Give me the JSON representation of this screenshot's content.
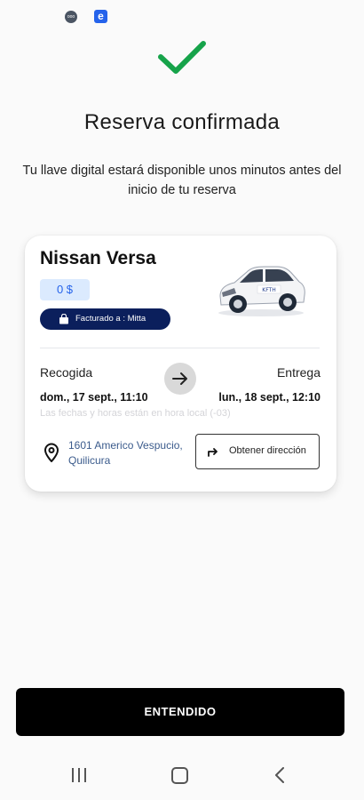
{
  "status_bar": {
    "dot_icon_text": "ooo",
    "e_icon_text": "e"
  },
  "confirmation": {
    "title": "Reserva confirmada",
    "subtitle": "Tu llave digital estará disponible unos minutos antes del inicio de tu reserva"
  },
  "booking_card": {
    "car_name": "Nissan Versa",
    "price": "0 $",
    "billing": "Facturado a : Mitta",
    "pickup": {
      "label": "Recogida",
      "date": "dom., 17 sept., 11:10"
    },
    "return": {
      "label": "Entrega",
      "date": "lun., 18 sept., 12:10"
    },
    "timezone_note": "Las fechas y horas están en hora local (-03)",
    "address": "1601 Americo Vespucio, Quilicura",
    "directions_button": "Obtener dirección"
  },
  "primary_button": "ENTENDIDO",
  "colors": {
    "accent_green": "#16a34a",
    "billing_badge": "#0b1f5c",
    "price_badge_bg": "#dbeafe",
    "price_text": "#2563eb",
    "address_text": "#3b5b8c",
    "primary_button": "#000000"
  },
  "icons": [
    "checkmark-icon",
    "shopping-bag-icon",
    "arrow-right-icon",
    "location-pin-icon",
    "turn-right-icon",
    "recents-icon",
    "home-icon",
    "back-icon"
  ]
}
